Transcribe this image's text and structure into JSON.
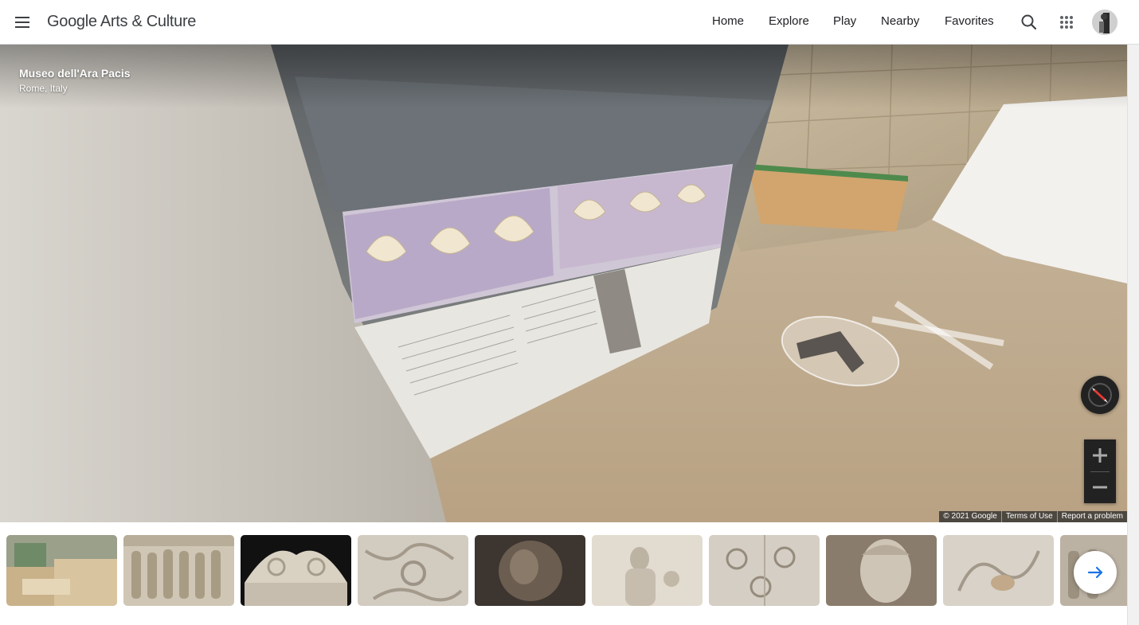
{
  "header": {
    "menu_icon": "hamburger-menu-icon",
    "logo_text": "Google Arts & Culture",
    "nav": [
      "Home",
      "Explore",
      "Play",
      "Nearby",
      "Favorites"
    ],
    "search_icon": "search-icon",
    "apps_icon": "apps-grid-icon",
    "avatar_icon": "user-avatar"
  },
  "location": {
    "title": "Museo dell'Ara Pacis",
    "subtitle": "Rome, Italy"
  },
  "controls": {
    "compass_icon": "compass-icon",
    "zoom_in_icon": "plus-icon",
    "zoom_out_icon": "minus-icon",
    "next_icon": "arrow-right-icon"
  },
  "attribution": {
    "copyright": "© 2021 Google",
    "terms": "Terms of Use",
    "report": "Report a problem"
  },
  "thumbnails": [
    "museum-interior-thumbnail",
    "procession-relief-thumbnail",
    "pediment-relief-thumbnail",
    "acanthus-scroll-thumbnail",
    "dark-sculpture-thumbnail",
    "tellus-panel-thumbnail",
    "floral-frieze-thumbnail",
    "marble-head-thumbnail",
    "vine-scroll-thumbnail",
    "relief-fragment-thumbnail"
  ],
  "colors": {
    "text_primary": "#202124",
    "logo_text": "#3c4043",
    "control_bg": "#222222",
    "accent_blue": "#1a73e8",
    "compass_red": "#e53935"
  }
}
